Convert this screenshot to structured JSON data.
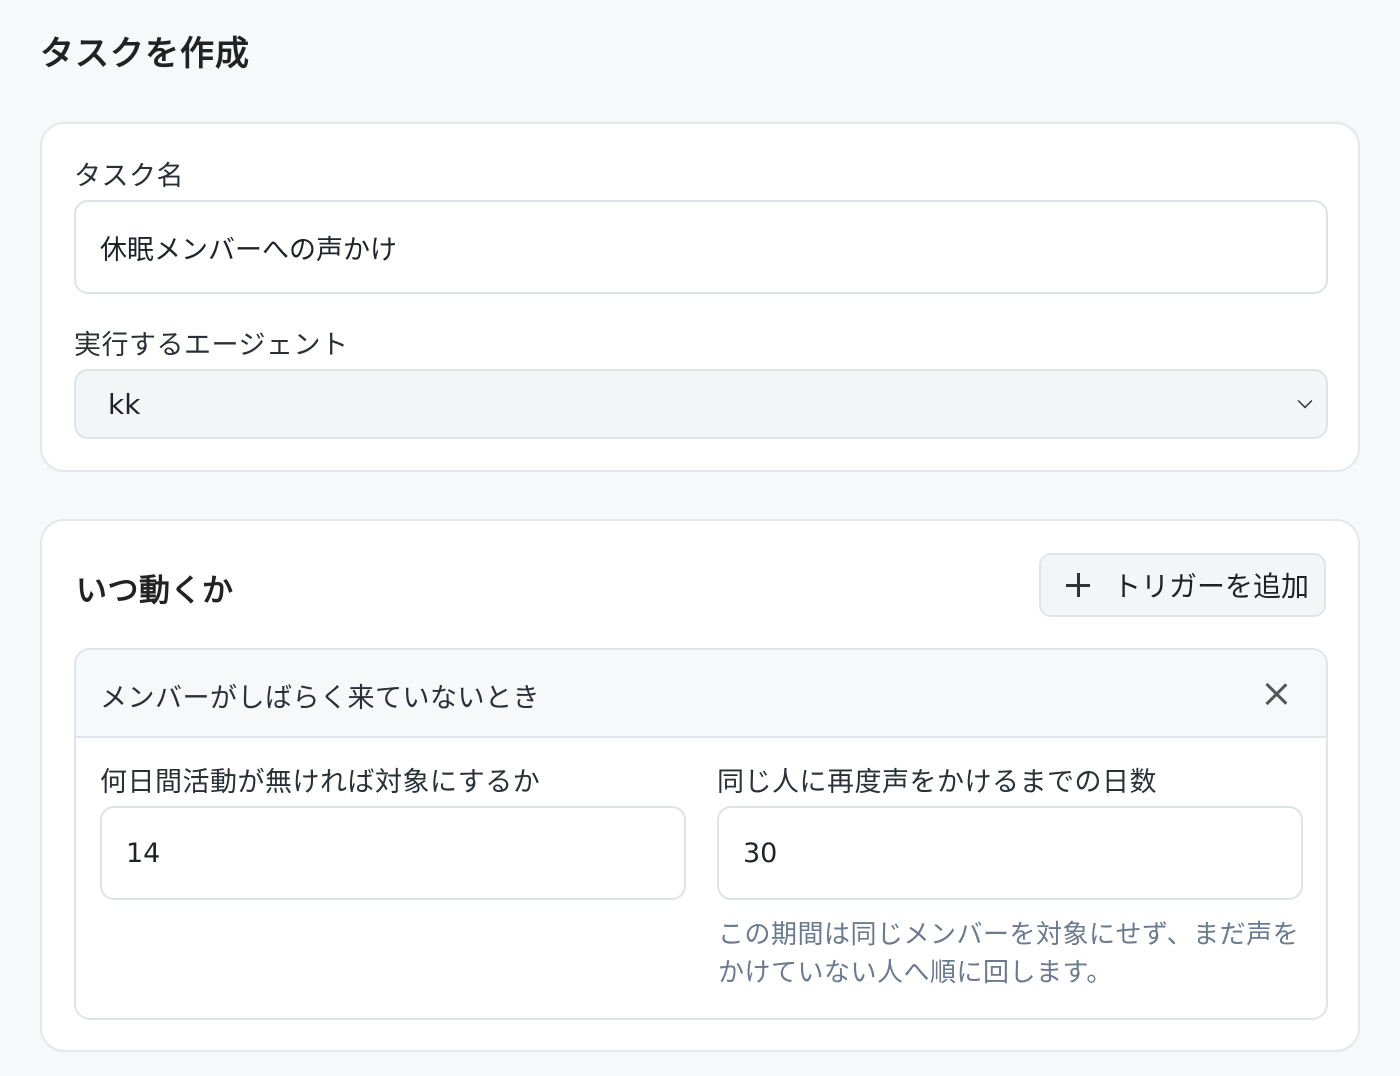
{
  "page": {
    "title": "タスクを作成"
  },
  "basic": {
    "task_name_label": "タスク名",
    "task_name_value": "休眠メンバーへの声かけ",
    "agent_label": "実行するエージェント",
    "agent_selected": "kk"
  },
  "triggers": {
    "section_title": "いつ動くか",
    "add_button_label": "トリガーを追加",
    "items": [
      {
        "title": "メンバーがしばらく来ていないとき",
        "inactive_days_label": "何日間活動が無ければ対象にするか",
        "inactive_days_value": "14",
        "cooldown_days_label": "同じ人に再度声をかけるまでの日数",
        "cooldown_days_value": "30",
        "cooldown_help": "この期間は同じメンバーを対象にせず、まだ声をかけていない人へ順に回します。"
      }
    ]
  },
  "colors": {
    "background": "#f7f8fa",
    "card_border": "#e4e7ec",
    "help_text": "#6b7a90"
  },
  "icons": {
    "add": "plus-icon",
    "remove": "close-icon",
    "select": "chevron-down-icon"
  }
}
